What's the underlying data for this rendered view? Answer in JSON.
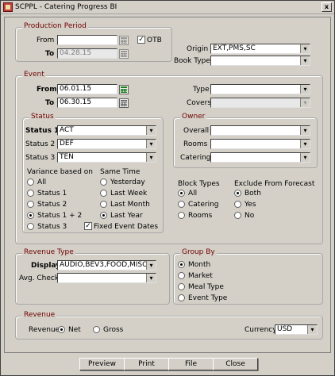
{
  "window": {
    "title": "SCPPL - Catering Progress BI"
  },
  "production_period": {
    "label": "Production Period",
    "from_label": "From",
    "from_value": "",
    "otb_label": "OTB",
    "otb_checked": true,
    "to_label": "To",
    "to_value": "04.28.15"
  },
  "origin": {
    "label": "Origin",
    "value": "EXT,PMS,SC"
  },
  "book_type": {
    "label": "Book Type",
    "value": ""
  },
  "event": {
    "label": "Event",
    "from_label": "From",
    "from_value": "06.01.15",
    "to_label": "To",
    "to_value": "06.30.15",
    "type_label": "Type",
    "type_value": "",
    "covers_label": "Covers",
    "covers_value": ""
  },
  "status": {
    "label": "Status",
    "status1_label": "Status 1",
    "status1_value": "ACT",
    "status2_label": "Status 2",
    "status2_value": "DEF",
    "status3_label": "Status 3",
    "status3_value": "TEN",
    "variance_label": "Variance based on",
    "variance_options": [
      "All",
      "Status 1",
      "Status 2",
      "Status 1 + 2",
      "Status 3"
    ],
    "variance_selected": "Status 1 + 2",
    "same_time_label": "Same Time",
    "same_time_options": [
      "Yesterday",
      "Last Week",
      "Last Month",
      "Last Year"
    ],
    "same_time_selected": "Last Year",
    "fixed_event_dates_label": "Fixed Event Dates",
    "fixed_event_dates_checked": true
  },
  "owner": {
    "label": "Owner",
    "overall_label": "Overall",
    "rooms_label": "Rooms",
    "catering_label": "Catering"
  },
  "block_types": {
    "label": "Block Types",
    "options": [
      "All",
      "Catering",
      "Rooms"
    ],
    "selected": "All"
  },
  "exclude_forecast": {
    "label": "Exclude From Forecast",
    "options": [
      "Both",
      "Yes",
      "No"
    ],
    "selected": "Both"
  },
  "revenue_type": {
    "label": "Revenue Type",
    "display_label": "Display",
    "display_value": "AUDIO,BEV3,FOOD,MISC,R",
    "avg_check_label": "Avg. Check",
    "avg_check_value": ""
  },
  "group_by": {
    "label": "Group By",
    "options": [
      "Month",
      "Market",
      "Meal Type",
      "Event Type"
    ],
    "selected": "Month"
  },
  "revenue": {
    "label": "Revenue",
    "revenue_label": "Revenue",
    "options": [
      "Net",
      "Gross"
    ],
    "selected": "Net",
    "currency_label": "Currency",
    "currency_value": "USD"
  },
  "buttons": {
    "preview": "Preview",
    "print": "Print",
    "file": "File",
    "close": "Close"
  },
  "icons": {
    "dropdown": "▾",
    "close_glyph": "x",
    "check_glyph": "✓"
  }
}
